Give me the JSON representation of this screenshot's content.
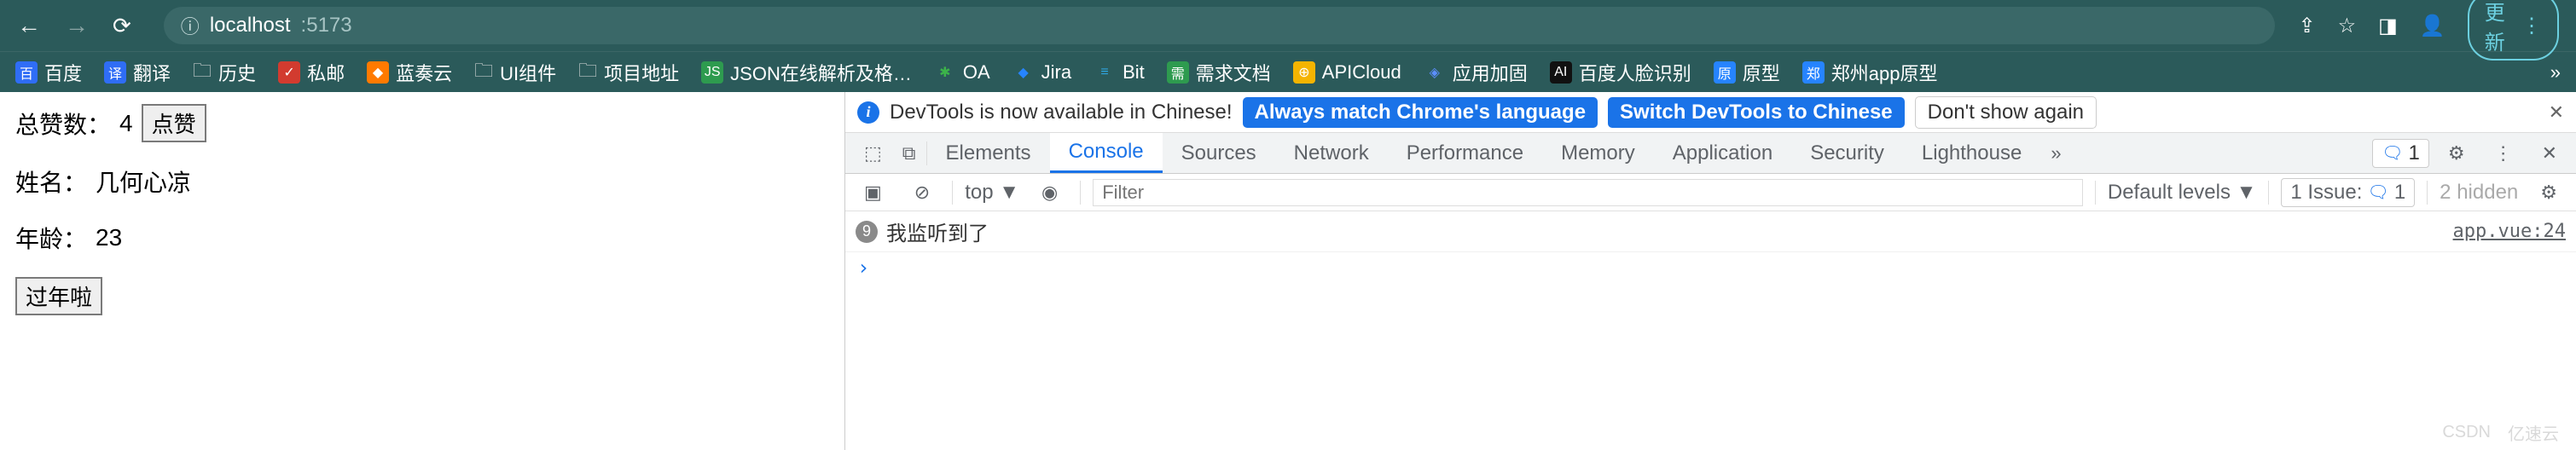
{
  "browser": {
    "url_host": "localhost",
    "url_port": ":5173",
    "update_label": "更新"
  },
  "bookmarks": [
    {
      "label": "百度",
      "color": "#2f6df6"
    },
    {
      "label": "翻译",
      "color": "#2f6df6"
    },
    {
      "label": "历史",
      "folder": true
    },
    {
      "label": "私邮",
      "color": "#d23b2f"
    },
    {
      "label": "蓝奏云",
      "color": "#ff7a00"
    },
    {
      "label": "UI组件",
      "folder": true
    },
    {
      "label": "项目地址",
      "folder": true
    },
    {
      "label": "JSON在线解析及格…",
      "color": "#2e9b4f"
    },
    {
      "label": "OA",
      "color": "#3cb34a"
    },
    {
      "label": "Jira",
      "color": "#2684ff"
    },
    {
      "label": "Bit",
      "color": "#2fa6e0"
    },
    {
      "label": "需求文档",
      "color": "#2e9b4f"
    },
    {
      "label": "APICloud",
      "color": "#f5b400"
    },
    {
      "label": "应用加固",
      "color": "#3c3cff"
    },
    {
      "label": "百度人脸识别",
      "color": "#111"
    },
    {
      "label": "原型",
      "color": "#2684ff"
    },
    {
      "label": "郑州app原型",
      "color": "#2684ff"
    }
  ],
  "page": {
    "likes_label": "总赞数：",
    "likes_value": "4",
    "like_btn": "点赞",
    "name_label": "姓名：",
    "name_value": "几何心凉",
    "age_label": "年龄：",
    "age_value": "23",
    "birthday_btn": "过年啦"
  },
  "devtools": {
    "banner": {
      "text": "DevTools is now available in Chinese!",
      "btn1": "Always match Chrome's language",
      "btn2": "Switch DevTools to Chinese",
      "btn3": "Don't show again"
    },
    "tabs": [
      "Elements",
      "Console",
      "Sources",
      "Network",
      "Performance",
      "Memory",
      "Application",
      "Security",
      "Lighthouse"
    ],
    "active_tab": "Console",
    "issues_count": "1",
    "console_bar": {
      "context": "top ▼",
      "filter_placeholder": "Filter",
      "levels": "Default levels ▼",
      "issue_label": "1 Issue:",
      "issue_count": "1",
      "hidden": "2 hidden"
    },
    "console": {
      "count": "9",
      "message": "我监听到了",
      "source": "app.vue:24",
      "prompt": "›"
    }
  },
  "watermark": {
    "a": "CSDN",
    "b": "亿速云"
  }
}
